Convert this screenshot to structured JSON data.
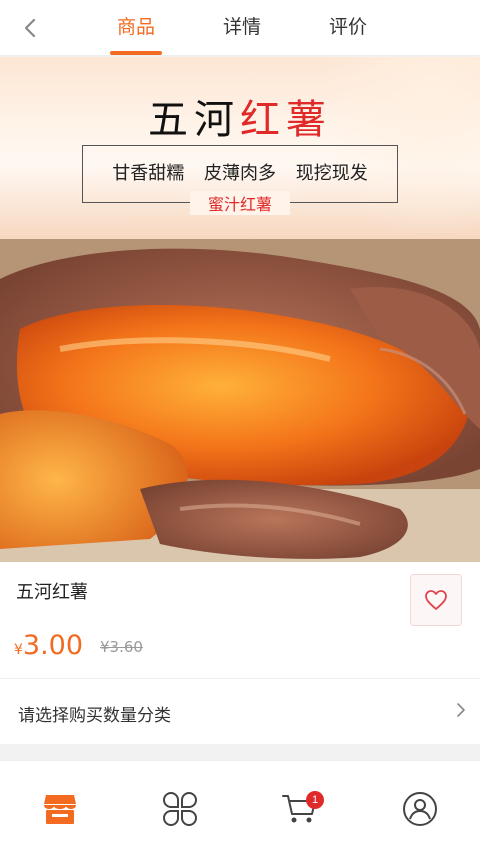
{
  "colors": {
    "accent": "#f26b21",
    "title_red": "#e02a2a",
    "badge": "#e02a2a"
  },
  "nav": {
    "back_icon": "chevron-left-icon",
    "tabs": [
      {
        "label": "商品",
        "active": true
      },
      {
        "label": "详情",
        "active": false
      },
      {
        "label": "评价",
        "active": false
      }
    ]
  },
  "banner": {
    "title_part1": "五河",
    "title_part2": "红薯",
    "tags": "甘香甜糯 皮薄肉多 现挖现发",
    "subtitle": "蜜汁红薯"
  },
  "product": {
    "name": "五河红薯",
    "currency": "¥",
    "price": "3.00",
    "original_price": "¥3.60",
    "favorite_icon": "heart-outline-icon",
    "select_label": "请选择购买数量分类",
    "select_icon": "chevron-right-icon"
  },
  "tabbar": {
    "items": [
      {
        "icon": "shop-icon",
        "active": true
      },
      {
        "icon": "category-grid-icon",
        "active": false
      },
      {
        "icon": "cart-icon",
        "active": false
      },
      {
        "icon": "user-icon",
        "active": false
      }
    ],
    "cart_badge": "1"
  }
}
